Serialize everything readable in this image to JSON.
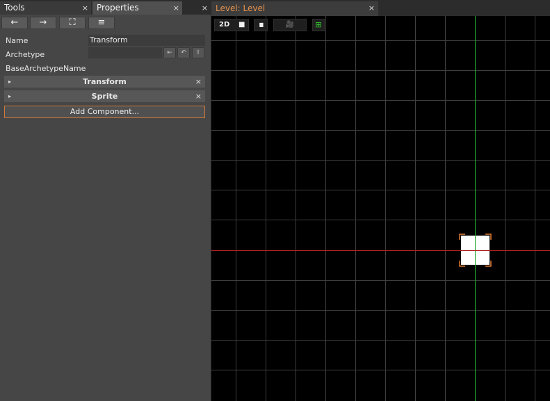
{
  "tabs": {
    "tools": {
      "label": "Tools",
      "close": "×"
    },
    "properties": {
      "label": "Properties",
      "close": "×"
    },
    "extra_close": "×"
  },
  "toolbar": {
    "back_icon": "←",
    "forward_icon": "→",
    "select_icon": "⛶",
    "list_icon": "≡"
  },
  "properties": {
    "name_label": "Name",
    "name_value": "Transform",
    "archetype_label": "Archetype",
    "archetype_value": "",
    "archetype_buttons": [
      "⇤",
      "↶",
      "⇧"
    ],
    "base_archetype_label": "BaseArchetypeName",
    "components": [
      {
        "label": "Transform",
        "arrow": "▸",
        "close": "×"
      },
      {
        "label": "Sprite",
        "arrow": "▸",
        "close": "×"
      }
    ],
    "add_component_label": "Add Component..."
  },
  "level_tab": {
    "label": "Level: Level",
    "close": "×"
  },
  "viewport_toolbar": {
    "mode_2d": "2D",
    "square_icon": "■",
    "split_icon": "▮▮",
    "camera_icon": "🎥",
    "grid_icon": "⊞"
  },
  "colors": {
    "accent_orange": "#e6924d",
    "grid_line": "#3f3f3f",
    "x_axis": "#b02020",
    "y_axis": "#20a830",
    "selection": "#e07a30"
  }
}
